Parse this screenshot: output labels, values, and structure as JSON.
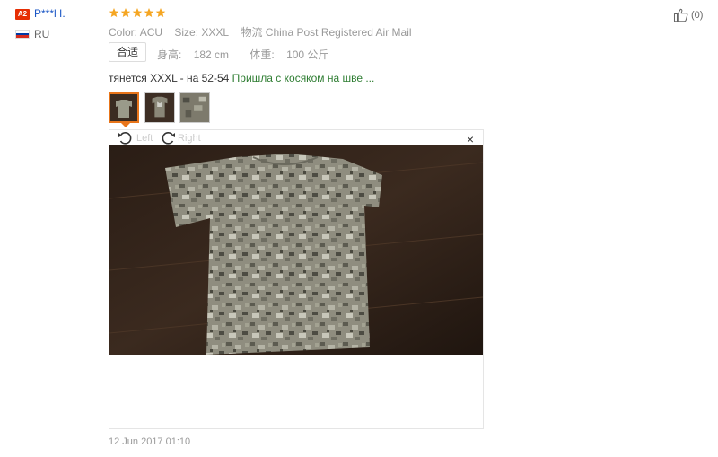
{
  "reviewer": {
    "badge": "A2",
    "name": "P***l I.",
    "country": "RU",
    "flag_colors": [
      "#ffffff",
      "#0039a6",
      "#d52b1e"
    ]
  },
  "rating": {
    "stars": 5,
    "star_color": "#f5a623"
  },
  "attributes": [
    {
      "label": "Color:",
      "value": "ACU"
    },
    {
      "label": "Size:",
      "value": "XXXL"
    },
    {
      "label": "物流",
      "value": "China Post Registered Air Mail"
    }
  ],
  "fit": {
    "label": "合适",
    "height_label": "身高:",
    "height_value": "182 cm",
    "weight_label": "体重:",
    "weight_value": "100 公斤"
  },
  "review": {
    "text_part1": "тянется XXXL - на 52-54 ",
    "text_part2": "Пришла с косяком на шве ...",
    "accent_color": "#2e7d32"
  },
  "viewer": {
    "rotate_left": "Left",
    "rotate_right": "Right",
    "close": "×"
  },
  "date": "12 Jun 2017 01:10",
  "helpful": {
    "count": "(0)"
  },
  "icons": [
    "thumbs-up-icon",
    "rotate-left-icon",
    "rotate-right-icon",
    "close-icon",
    "star-icon"
  ]
}
